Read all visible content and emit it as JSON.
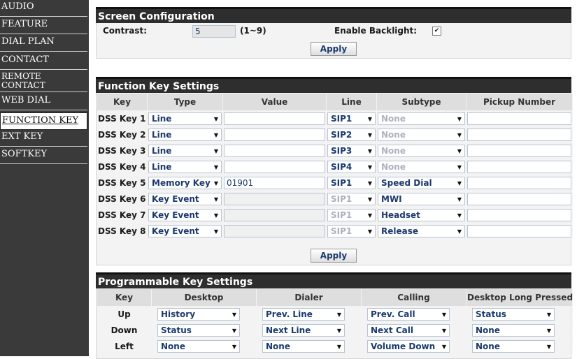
{
  "sidebar": {
    "items": [
      {
        "label": "AUDIO"
      },
      {
        "label": "FEATURE"
      },
      {
        "label": "DIAL PLAN"
      },
      {
        "label": "CONTACT"
      },
      {
        "label": "REMOTE CONTACT"
      },
      {
        "label": "WEB DIAL"
      },
      {
        "label": "FUNCTION KEY"
      },
      {
        "label": "EXT KEY"
      },
      {
        "label": "SOFTKEY"
      }
    ],
    "active": "FUNCTION KEY"
  },
  "screen": {
    "title": "Screen Configuration",
    "contrast_label": "Contrast:",
    "contrast_value": "5",
    "contrast_range": "(1~9)",
    "backlight_label": "Enable Backlight:",
    "backlight_checked": "✔",
    "apply": "Apply"
  },
  "fkey": {
    "title": "Function Key Settings",
    "headers": [
      "Key",
      "Type",
      "Value",
      "Line",
      "Subtype",
      "Pickup Number"
    ],
    "rows": [
      {
        "key": "DSS Key 1",
        "type": "Line",
        "value": "",
        "line": "SIP1",
        "subtype": "None",
        "pickup": ""
      },
      {
        "key": "DSS Key 2",
        "type": "Line",
        "value": "",
        "line": "SIP2",
        "subtype": "None",
        "pickup": ""
      },
      {
        "key": "DSS Key 3",
        "type": "Line",
        "value": "",
        "line": "SIP3",
        "subtype": "None",
        "pickup": ""
      },
      {
        "key": "DSS Key 4",
        "type": "Line",
        "value": "",
        "line": "SIP4",
        "subtype": "None",
        "pickup": ""
      },
      {
        "key": "DSS Key 5",
        "type": "Memory Key",
        "value": "01901",
        "line": "SIP1",
        "subtype": "Speed Dial",
        "pickup": ""
      },
      {
        "key": "DSS Key 6",
        "type": "Key Event",
        "value": "",
        "line": "SIP1",
        "subtype": "MWI",
        "pickup": ""
      },
      {
        "key": "DSS Key 7",
        "type": "Key Event",
        "value": "",
        "line": "SIP1",
        "subtype": "Headset",
        "pickup": ""
      },
      {
        "key": "DSS Key 8",
        "type": "Key Event",
        "value": "",
        "line": "SIP1",
        "subtype": "Release",
        "pickup": ""
      }
    ],
    "apply": "Apply"
  },
  "pkey": {
    "title": "Programmable Key Settings",
    "headers": [
      "Key",
      "Desktop",
      "Dialer",
      "Calling",
      "Desktop Long Pressed"
    ],
    "rows": [
      {
        "key": "Up",
        "desktop": "History",
        "dialer": "Prev. Line",
        "calling": "Prev. Call",
        "long": "Status"
      },
      {
        "key": "Down",
        "desktop": "Status",
        "dialer": "Next Line",
        "calling": "Next Call",
        "long": "None"
      },
      {
        "key": "Left",
        "desktop": "None",
        "dialer": "None",
        "calling": "Volume Down",
        "long": "None"
      }
    ]
  }
}
